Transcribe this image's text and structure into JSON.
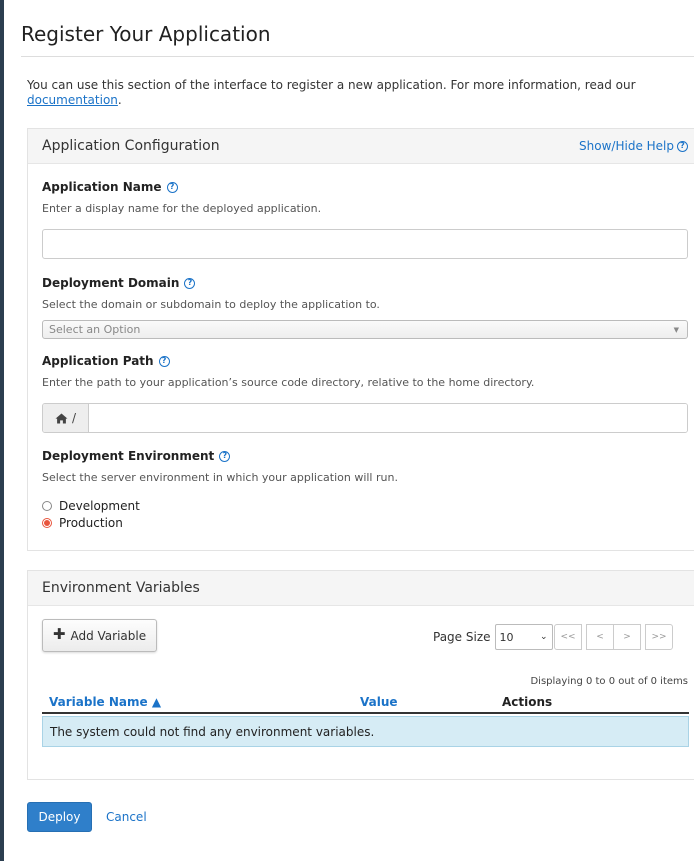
{
  "page": {
    "title": "Register Your Application",
    "intro_text": "You can use this section of the interface to register a new application. For more information, read our",
    "intro_link": "documentation",
    "intro_end": "."
  },
  "config_panel": {
    "heading": "Application Configuration",
    "help_link": "Show/Hide Help",
    "app_name": {
      "label": "Application Name",
      "help": "Enter a display name for the deployed application.",
      "value": ""
    },
    "domain": {
      "label": "Deployment Domain",
      "help": "Select the domain or subdomain to deploy the application to.",
      "selected": "Select an Option"
    },
    "path": {
      "label": "Application Path",
      "help": "Enter the path to your application’s source code directory, relative to the home directory.",
      "prefix": "/",
      "value": ""
    },
    "environment": {
      "label": "Deployment Environment",
      "help": "Select the server environment in which your application will run.",
      "options": [
        "Development",
        "Production"
      ],
      "selected": "Production"
    }
  },
  "env_panel": {
    "heading": "Environment Variables",
    "add_button": "Add Variable",
    "page_size_label": "Page Size",
    "page_size_value": "10",
    "pager": [
      "<<",
      "<",
      ">",
      ">>"
    ],
    "displaying": "Displaying 0 to 0 out of 0 items",
    "columns": [
      "Variable Name ▲",
      "Value",
      "Actions"
    ],
    "empty_message": "The system could not find any environment variables."
  },
  "footer": {
    "deploy": "Deploy",
    "cancel": "Cancel"
  },
  "colors": {
    "accent": "#1b73c8",
    "deploy_button": "#2f7fca",
    "radio_selected": "#e8553d",
    "empty_row": "#d6ecf5"
  }
}
